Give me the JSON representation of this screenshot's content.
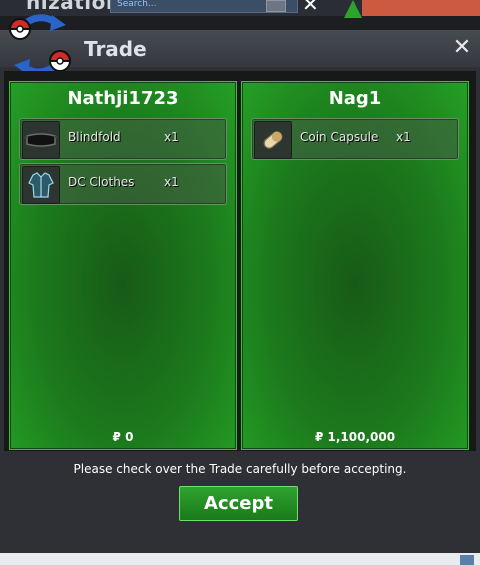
{
  "background": {
    "partial_title": "nizations",
    "search_placeholder": "Search..."
  },
  "window": {
    "title": "Trade",
    "close_symbol": "✕",
    "logo_icon": "pokeball-exchange-icon"
  },
  "left_panel": {
    "player_name": "Nathji1723",
    "items": [
      {
        "name": "Blindfold",
        "quantity": "x1",
        "icon": "blindfold-icon"
      },
      {
        "name": "DC Clothes",
        "quantity": "x1",
        "icon": "clothes-icon"
      }
    ],
    "money": "₽ 0"
  },
  "right_panel": {
    "player_name": "Nag1",
    "items": [
      {
        "name": "Coin Capsule",
        "quantity": "x1",
        "icon": "coin-capsule-icon"
      }
    ],
    "money": "₽ 1,100,000"
  },
  "notice": "Please check over the Trade carefully before accepting.",
  "accept_button": "Accept",
  "colors": {
    "panel_green": "#1c7a1c",
    "panel_border": "#3fbf3f",
    "accept_green": "#2fa22f"
  }
}
